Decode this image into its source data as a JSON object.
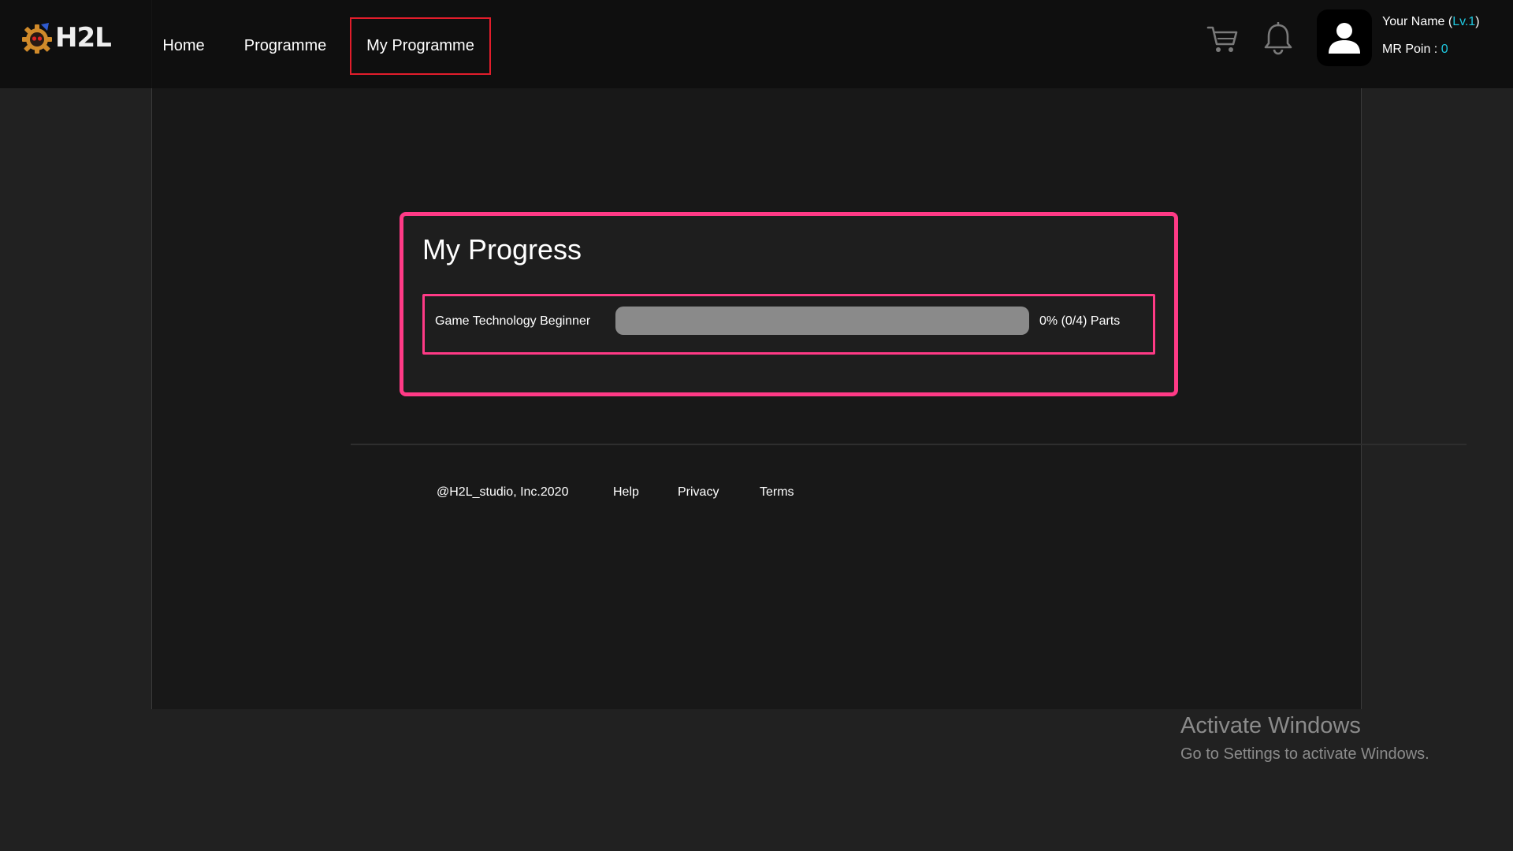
{
  "header": {
    "logo_text": "H2L",
    "nav": {
      "home": "Home",
      "programme": "Programme",
      "my_programme": "My Programme"
    },
    "icons": {
      "cart": "cart-icon",
      "bell": "bell-icon",
      "avatar": "user-avatar-icon"
    },
    "user": {
      "name": "Your Name",
      "level_open": "(",
      "level": "Lv.1",
      "level_close": ")",
      "points_label": "MR Poin : ",
      "points_value": "0"
    }
  },
  "progress": {
    "title": "My Progress",
    "items": [
      {
        "course": "Game Technology Beginner",
        "percent": 0,
        "label": "0% (0/4) Parts"
      }
    ]
  },
  "footer": {
    "copyright": "@H2L_studio, Inc.2020",
    "help": "Help",
    "privacy": "Privacy",
    "terms": "Terms"
  },
  "watermark": {
    "title": "Activate Windows",
    "subtitle": "Go to Settings to activate Windows."
  },
  "colors": {
    "accent_pink": "#ff3a86",
    "nav_active_border": "#e21d2b",
    "level_cyan": "#1ec8e0"
  }
}
